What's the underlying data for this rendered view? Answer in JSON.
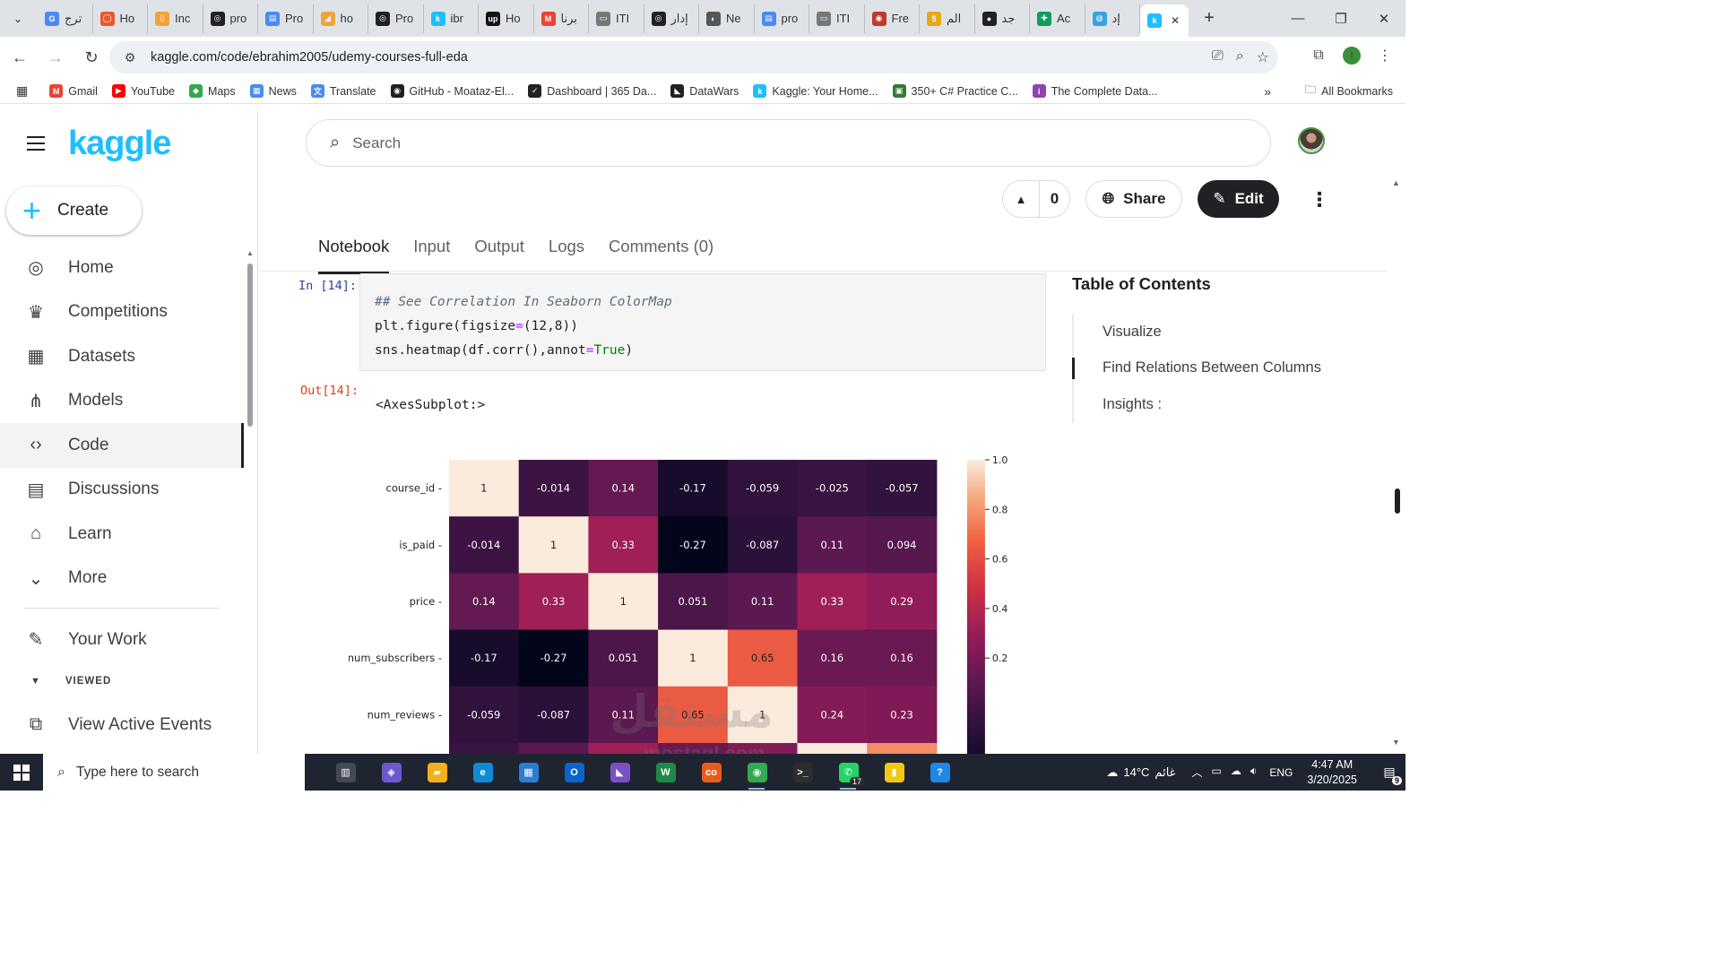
{
  "browser": {
    "tabs": [
      {
        "label": "ترج",
        "color": "#4a8af4",
        "glyph": "G"
      },
      {
        "label": "Ho",
        "color": "#e8592b",
        "glyph": "◯"
      },
      {
        "label": "Inc",
        "color": "#f2a33a",
        "glyph": "▯"
      },
      {
        "label": "pro",
        "color": "#202124",
        "glyph": "◎"
      },
      {
        "label": "Pro",
        "color": "#4a8af4",
        "glyph": "▤"
      },
      {
        "label": "ho",
        "color": "#f2a33a",
        "glyph": "◢"
      },
      {
        "label": "Pro",
        "color": "#202124",
        "glyph": "◎"
      },
      {
        "label": "ibr",
        "color": "#20beff",
        "glyph": "k"
      },
      {
        "label": "Ho",
        "color": "#111111",
        "glyph": "up"
      },
      {
        "label": "برنا",
        "color": "#ea4335",
        "glyph": "M"
      },
      {
        "label": "ITI",
        "color": "#777777",
        "glyph": "▭"
      },
      {
        "label": "إدار",
        "color": "#202124",
        "glyph": "◎"
      },
      {
        "label": "Ne",
        "color": "#555555",
        "glyph": "◐"
      },
      {
        "label": "pro",
        "color": "#4a8af4",
        "glyph": "▤"
      },
      {
        "label": "ITI",
        "color": "#777777",
        "glyph": "▭"
      },
      {
        "label": "Fre",
        "color": "#c0392b",
        "glyph": "◉"
      },
      {
        "label": "الم",
        "color": "#e6a817",
        "glyph": "5"
      },
      {
        "label": "جد",
        "color": "#202124",
        "glyph": "●"
      },
      {
        "label": "Ac",
        "color": "#0f9d58",
        "glyph": "✚"
      },
      {
        "label": "إد",
        "color": "#3aa3e3",
        "glyph": "◍"
      },
      {
        "label": "",
        "color": "#20beff",
        "glyph": "k"
      }
    ],
    "url": "kaggle.com/code/ebrahim2005/udemy-courses-full-eda",
    "profile_initial": "I",
    "bookmarks": [
      {
        "label": "Gmail",
        "color": "#ea4335",
        "glyph": "M"
      },
      {
        "label": "YouTube",
        "color": "#ff0000",
        "glyph": "▶"
      },
      {
        "label": "Maps",
        "color": "#34a853",
        "glyph": "◆"
      },
      {
        "label": "News",
        "color": "#4a8af4",
        "glyph": "▦"
      },
      {
        "label": "Translate",
        "color": "#4a8af4",
        "glyph": "文"
      },
      {
        "label": "GitHub - Moataz-El...",
        "color": "#202124",
        "glyph": "◉"
      },
      {
        "label": "Dashboard | 365 Da...",
        "color": "#202124",
        "glyph": "✓"
      },
      {
        "label": "DataWars",
        "color": "#202124",
        "glyph": "◣"
      },
      {
        "label": "Kaggle: Your Home...",
        "color": "#20beff",
        "glyph": "k"
      },
      {
        "label": "350+ C# Practice C...",
        "color": "#2e7d32",
        "glyph": "▣"
      },
      {
        "label": "The Complete Data...",
        "color": "#8e44ad",
        "glyph": "i"
      }
    ],
    "all_bookmarks": "All Bookmarks"
  },
  "kaggle": {
    "logo": "kaggle",
    "create_label": "Create",
    "nav": [
      {
        "label": "Home",
        "icon": "◎"
      },
      {
        "label": "Competitions",
        "icon": "♛"
      },
      {
        "label": "Datasets",
        "icon": "▦"
      },
      {
        "label": "Models",
        "icon": "⋔"
      },
      {
        "label": "Code",
        "icon": "‹›"
      },
      {
        "label": "Discussions",
        "icon": "▤"
      },
      {
        "label": "Learn",
        "icon": "⌂"
      },
      {
        "label": "More",
        "icon": "⌄"
      }
    ],
    "your_work": "Your Work",
    "viewed": "VIEWED",
    "view_active_events": "View Active Events",
    "search_placeholder": "Search",
    "vote_count": "0",
    "share_label": "Share",
    "edit_label": "Edit",
    "notebook_tabs": [
      "Notebook",
      "Input",
      "Output",
      "Logs",
      "Comments (0)"
    ],
    "cell": {
      "in_prompt": "In [14]:",
      "out_prompt": "Out[14]:",
      "comment": "## See Correlation In Seaborn ColorMap",
      "line2_a": "plt.figure(figsize",
      "line2_op": "=",
      "line2_b": "(12,8))",
      "line3_a": "sns.heatmap(df.corr(),annot",
      "line3_op": "=",
      "line3_kw": "True",
      "line3_b": ")",
      "output": "<AxesSubplot:>"
    },
    "toc": {
      "title": "Table of Contents",
      "items": [
        "Visualize",
        "Find Relations Between Columns",
        "Insights :"
      ]
    }
  },
  "chart_data": {
    "type": "heatmap",
    "rows": [
      "course_id",
      "is_paid",
      "price",
      "num_subscribers",
      "num_reviews"
    ],
    "values": [
      [
        "1",
        "-0.014",
        "0.14",
        "-0.17",
        "-0.059",
        "-0.025",
        "-0.057"
      ],
      [
        "-0.014",
        "1",
        "0.33",
        "-0.27",
        "-0.087",
        "0.11",
        "0.094"
      ],
      [
        "0.14",
        "0.33",
        "1",
        "0.051",
        "0.11",
        "0.33",
        "0.29"
      ],
      [
        "-0.17",
        "-0.27",
        "0.051",
        "1",
        "0.65",
        "0.16",
        "0.16"
      ],
      [
        "-0.059",
        "-0.087",
        "0.11",
        "0.65",
        "1",
        "0.24",
        "0.23"
      ]
    ],
    "colorbar_ticks": [
      "1.0",
      "0.8",
      "0.6",
      "0.4",
      "0.2"
    ],
    "colorbar_range": [
      -0.27,
      1.0
    ],
    "colormap": "rocket"
  },
  "watermark": {
    "main": "مستقل",
    "sub": "mostaql.com"
  },
  "taskbar": {
    "search_placeholder": "Type here to search",
    "apps": [
      {
        "name": "task-view",
        "color": "#444a55",
        "glyph": "▥",
        "running": false
      },
      {
        "name": "copilot",
        "color": "#6a5acd",
        "glyph": "◈",
        "running": false
      },
      {
        "name": "file-explorer",
        "color": "#f2b01e",
        "glyph": "▰",
        "running": false
      },
      {
        "name": "edge",
        "color": "#0f8bd6",
        "glyph": "e",
        "running": false
      },
      {
        "name": "store",
        "color": "#2b7cd3",
        "glyph": "▦",
        "running": false
      },
      {
        "name": "outlook",
        "color": "#0a64c9",
        "glyph": "O",
        "running": false
      },
      {
        "name": "visual-studio",
        "color": "#7b4fc7",
        "glyph": "◣",
        "running": false
      },
      {
        "name": "excel-wps",
        "color": "#1f8a48",
        "glyph": "W",
        "running": false
      },
      {
        "name": "cs-app",
        "color": "#e85d1e",
        "glyph": "co",
        "running": false
      },
      {
        "name": "chrome",
        "color": "#34a853",
        "glyph": "◉",
        "running": true
      },
      {
        "name": "terminal",
        "color": "#2d2d2d",
        "glyph": ">_",
        "running": false
      },
      {
        "name": "whatsapp",
        "color": "#25d366",
        "glyph": "✆",
        "running": true
      },
      {
        "name": "power-bi",
        "color": "#f2c811",
        "glyph": "▮",
        "running": false
      },
      {
        "name": "help",
        "color": "#1e88e5",
        "glyph": "?",
        "running": false
      }
    ],
    "whatsapp_badge": "17",
    "temperature": "14°C",
    "weather_text": "غائم",
    "language": "ENG",
    "time": "4:47 AM",
    "date": "3/20/2025",
    "notification_count": "9"
  }
}
